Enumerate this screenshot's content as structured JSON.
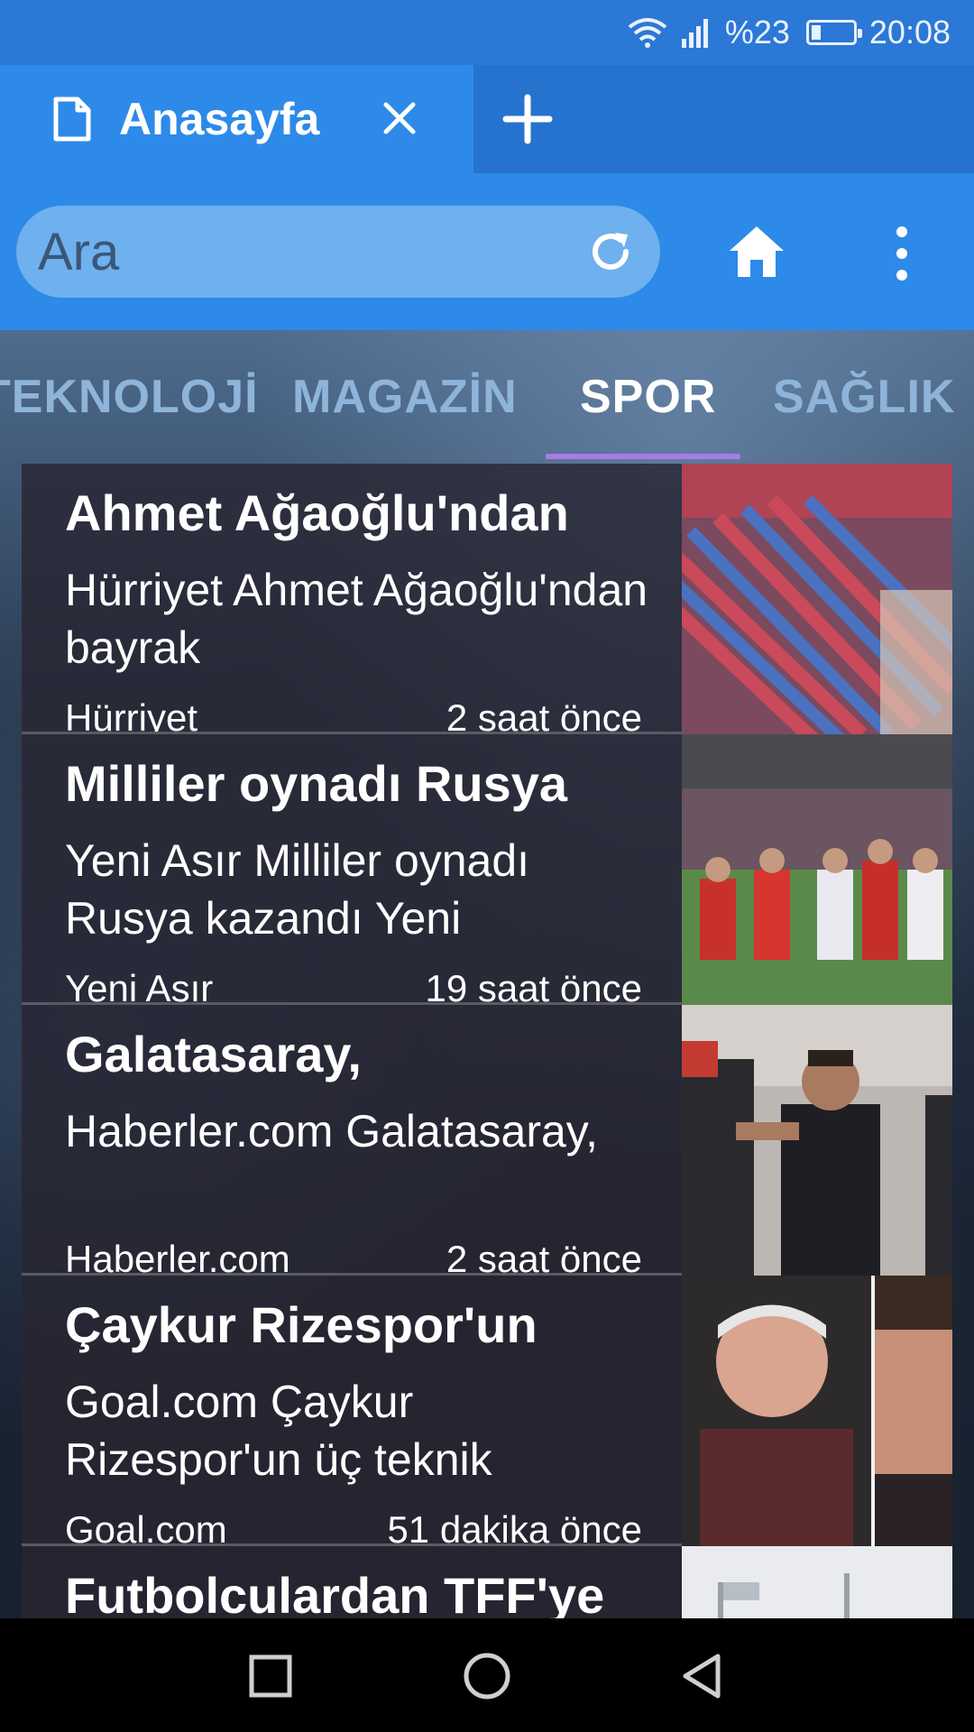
{
  "status_bar": {
    "battery_text": "%23",
    "battery_level": 0.23,
    "time": "20:08",
    "icons": [
      "wifi-icon",
      "signal-icon",
      "battery-icon"
    ]
  },
  "tab": {
    "title": "Anasayfa",
    "icons": [
      "page-icon",
      "close-icon",
      "plus-icon"
    ]
  },
  "search": {
    "placeholder": "Ara",
    "icons": [
      "reload-icon",
      "home-icon",
      "more-vert-icon"
    ]
  },
  "categories": [
    {
      "label": "TEKNOLOJİ",
      "active": false
    },
    {
      "label": "MAGAZİN",
      "active": false
    },
    {
      "label": "SPOR",
      "active": true
    },
    {
      "label": "SAĞLIK",
      "active": false
    }
  ],
  "news": [
    {
      "headline": "Ahmet Ağaoğlu'ndan",
      "summary": "Hürriyet Ahmet Ağaoğlu'ndan bayrak",
      "source": "Hürriyet",
      "time": "2 saat önce"
    },
    {
      "headline": "Milliler oynadı Rusya",
      "summary": "Yeni Asır Milliler oynadı Rusya kazandı Yeni",
      "source": "Yeni Asır",
      "time": "19 saat önce"
    },
    {
      "headline": "Galatasaray,",
      "summary": "Haberler.com Galatasaray,",
      "source": "Haberler.com",
      "time": "2 saat önce"
    },
    {
      "headline": "Çaykur Rizespor'un",
      "summary": "Goal.com Çaykur Rizespor'un üç teknik",
      "source": "Goal.com",
      "time": "51 dakika önce"
    },
    {
      "headline": "Futbolculardan TFF'ye",
      "summary": "",
      "source": "",
      "time": ""
    }
  ],
  "colors": {
    "status_bar": "#2b78d6",
    "toolbar": "#2d8ae8",
    "tab_strip": "#2672cf",
    "search_field": "#6fb0ee",
    "category_inactive": "#8fb4da",
    "category_underline": "#a77be8",
    "card_bg": "#2a2836"
  },
  "nav_bar": {
    "icons": [
      "recents-square-icon",
      "home-circle-icon",
      "back-triangle-icon"
    ]
  }
}
